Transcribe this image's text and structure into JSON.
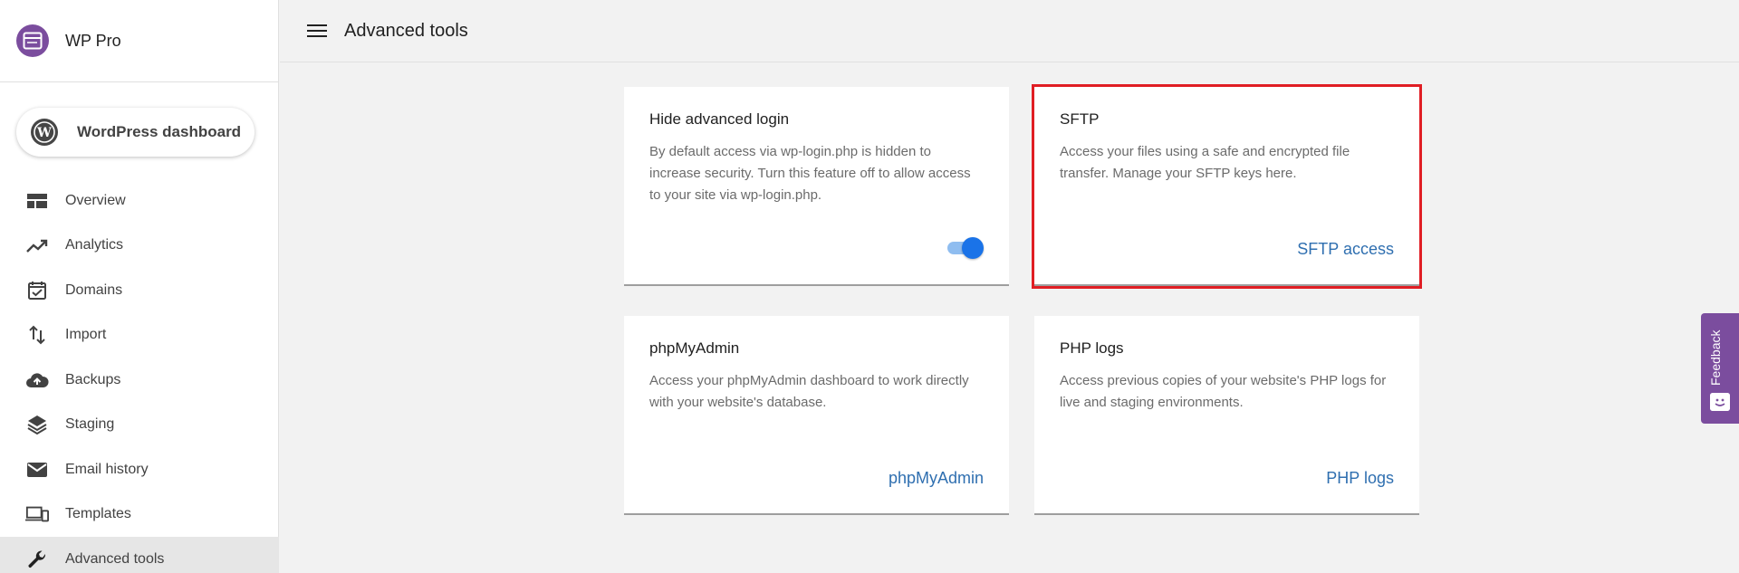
{
  "brand": {
    "name": "WP Pro"
  },
  "wp_button": {
    "label": "WordPress dashboard"
  },
  "nav": {
    "items": [
      {
        "label": "Overview",
        "icon": "overview-icon"
      },
      {
        "label": "Analytics",
        "icon": "analytics-icon"
      },
      {
        "label": "Domains",
        "icon": "domains-icon"
      },
      {
        "label": "Import",
        "icon": "import-icon"
      },
      {
        "label": "Backups",
        "icon": "backups-icon"
      },
      {
        "label": "Staging",
        "icon": "staging-icon"
      },
      {
        "label": "Email history",
        "icon": "email-icon"
      },
      {
        "label": "Templates",
        "icon": "templates-icon"
      },
      {
        "label": "Advanced tools",
        "icon": "wrench-icon",
        "active": true
      }
    ]
  },
  "header": {
    "title": "Advanced tools"
  },
  "cards": {
    "hide_login": {
      "title": "Hide advanced login",
      "description": "By default access via wp-login.php is hidden to increase security. Turn this feature off to allow access to your site via wp-login.php.",
      "toggle_on": true
    },
    "sftp": {
      "title": "SFTP",
      "description": "Access your files using a safe and encrypted file transfer. Manage your SFTP keys here.",
      "link": "SFTP access"
    },
    "phpmyadmin": {
      "title": "phpMyAdmin",
      "description": "Access your phpMyAdmin dashboard to work directly with your website's database.",
      "link": "phpMyAdmin"
    },
    "php_logs": {
      "title": "PHP logs",
      "description": "Access previous copies of your website's PHP logs for live and staging environments.",
      "link": "PHP logs"
    }
  },
  "feedback": {
    "label": "Feedback"
  },
  "colors": {
    "brand": "#7b4d9e",
    "link": "#2f6fb0",
    "highlight": "#e01e24",
    "toggle": "#1a73e8"
  }
}
